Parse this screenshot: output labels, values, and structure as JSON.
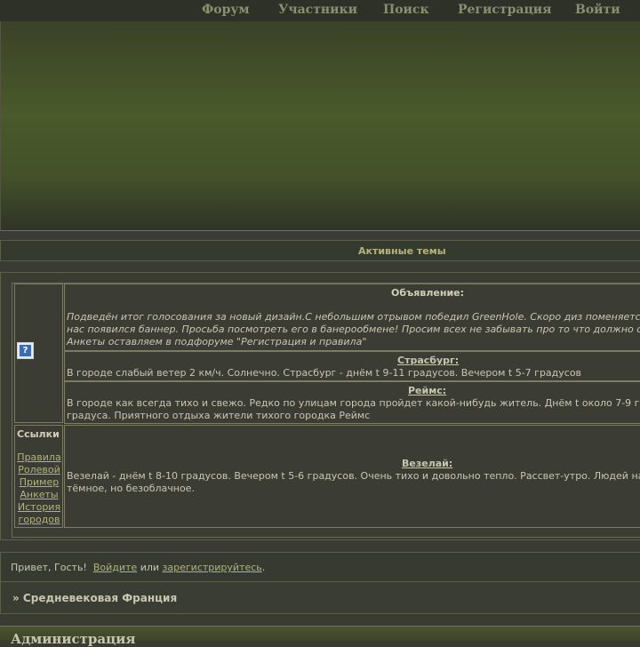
{
  "nav": {
    "items": [
      "Форум",
      "Участники",
      "Поиск",
      "Регистрация",
      "Войти"
    ]
  },
  "active_topics": {
    "label": "Активные темы"
  },
  "announcement": {
    "title": "Объявление:",
    "lines": [
      "Подведён итог голосования за новый дизайн.С небольшим отрывом победил GreenHole. Скоро диз поменяется.",
      "нас появился баннер. Просьба посмотреть его в банерообмене! Просим всех не забывать про то что должно с",
      "Анкеты оставляем в подфоруме \"Регистрация и правила\""
    ]
  },
  "cities": [
    {
      "title": "Страсбург:",
      "lines": [
        "В городе слабый ветер 2 км/ч. Солнечно. Страсбург - днём t 9-11 градусов. Вечером t 5-7 градусов"
      ]
    },
    {
      "title": "Реймс:",
      "lines": [
        "В городе как всегда тихо и свежо. Редко по улицам города пройдет какой-нибудь житель. Днём t около 7-9 гр",
        "градуса. Приятного отдыха жители тихого городка Реймс"
      ]
    },
    {
      "title": "Везелай:",
      "lines": [
        "Везелай - днём t 8-10 градусов. Вечером t 5-6 градусов. Очень тихо и довольно тепло. Рассвет-утро. Людей на",
        "тёмное, но безоблачное."
      ]
    }
  ],
  "links": {
    "header": "Ссылки",
    "items": [
      "Правила",
      "Ролевой",
      "Пример",
      "Анкеты",
      "История",
      "городов"
    ]
  },
  "greeting": {
    "prefix": "Привет, Гость!",
    "login": "Войдите",
    "middle": "или",
    "register": "зарегистрируйтесь",
    "suffix": "."
  },
  "breadcrumb": {
    "text": "» Средневековая Франция"
  },
  "section": {
    "title": "Администрация"
  },
  "icons": {
    "help": "help-icon"
  }
}
